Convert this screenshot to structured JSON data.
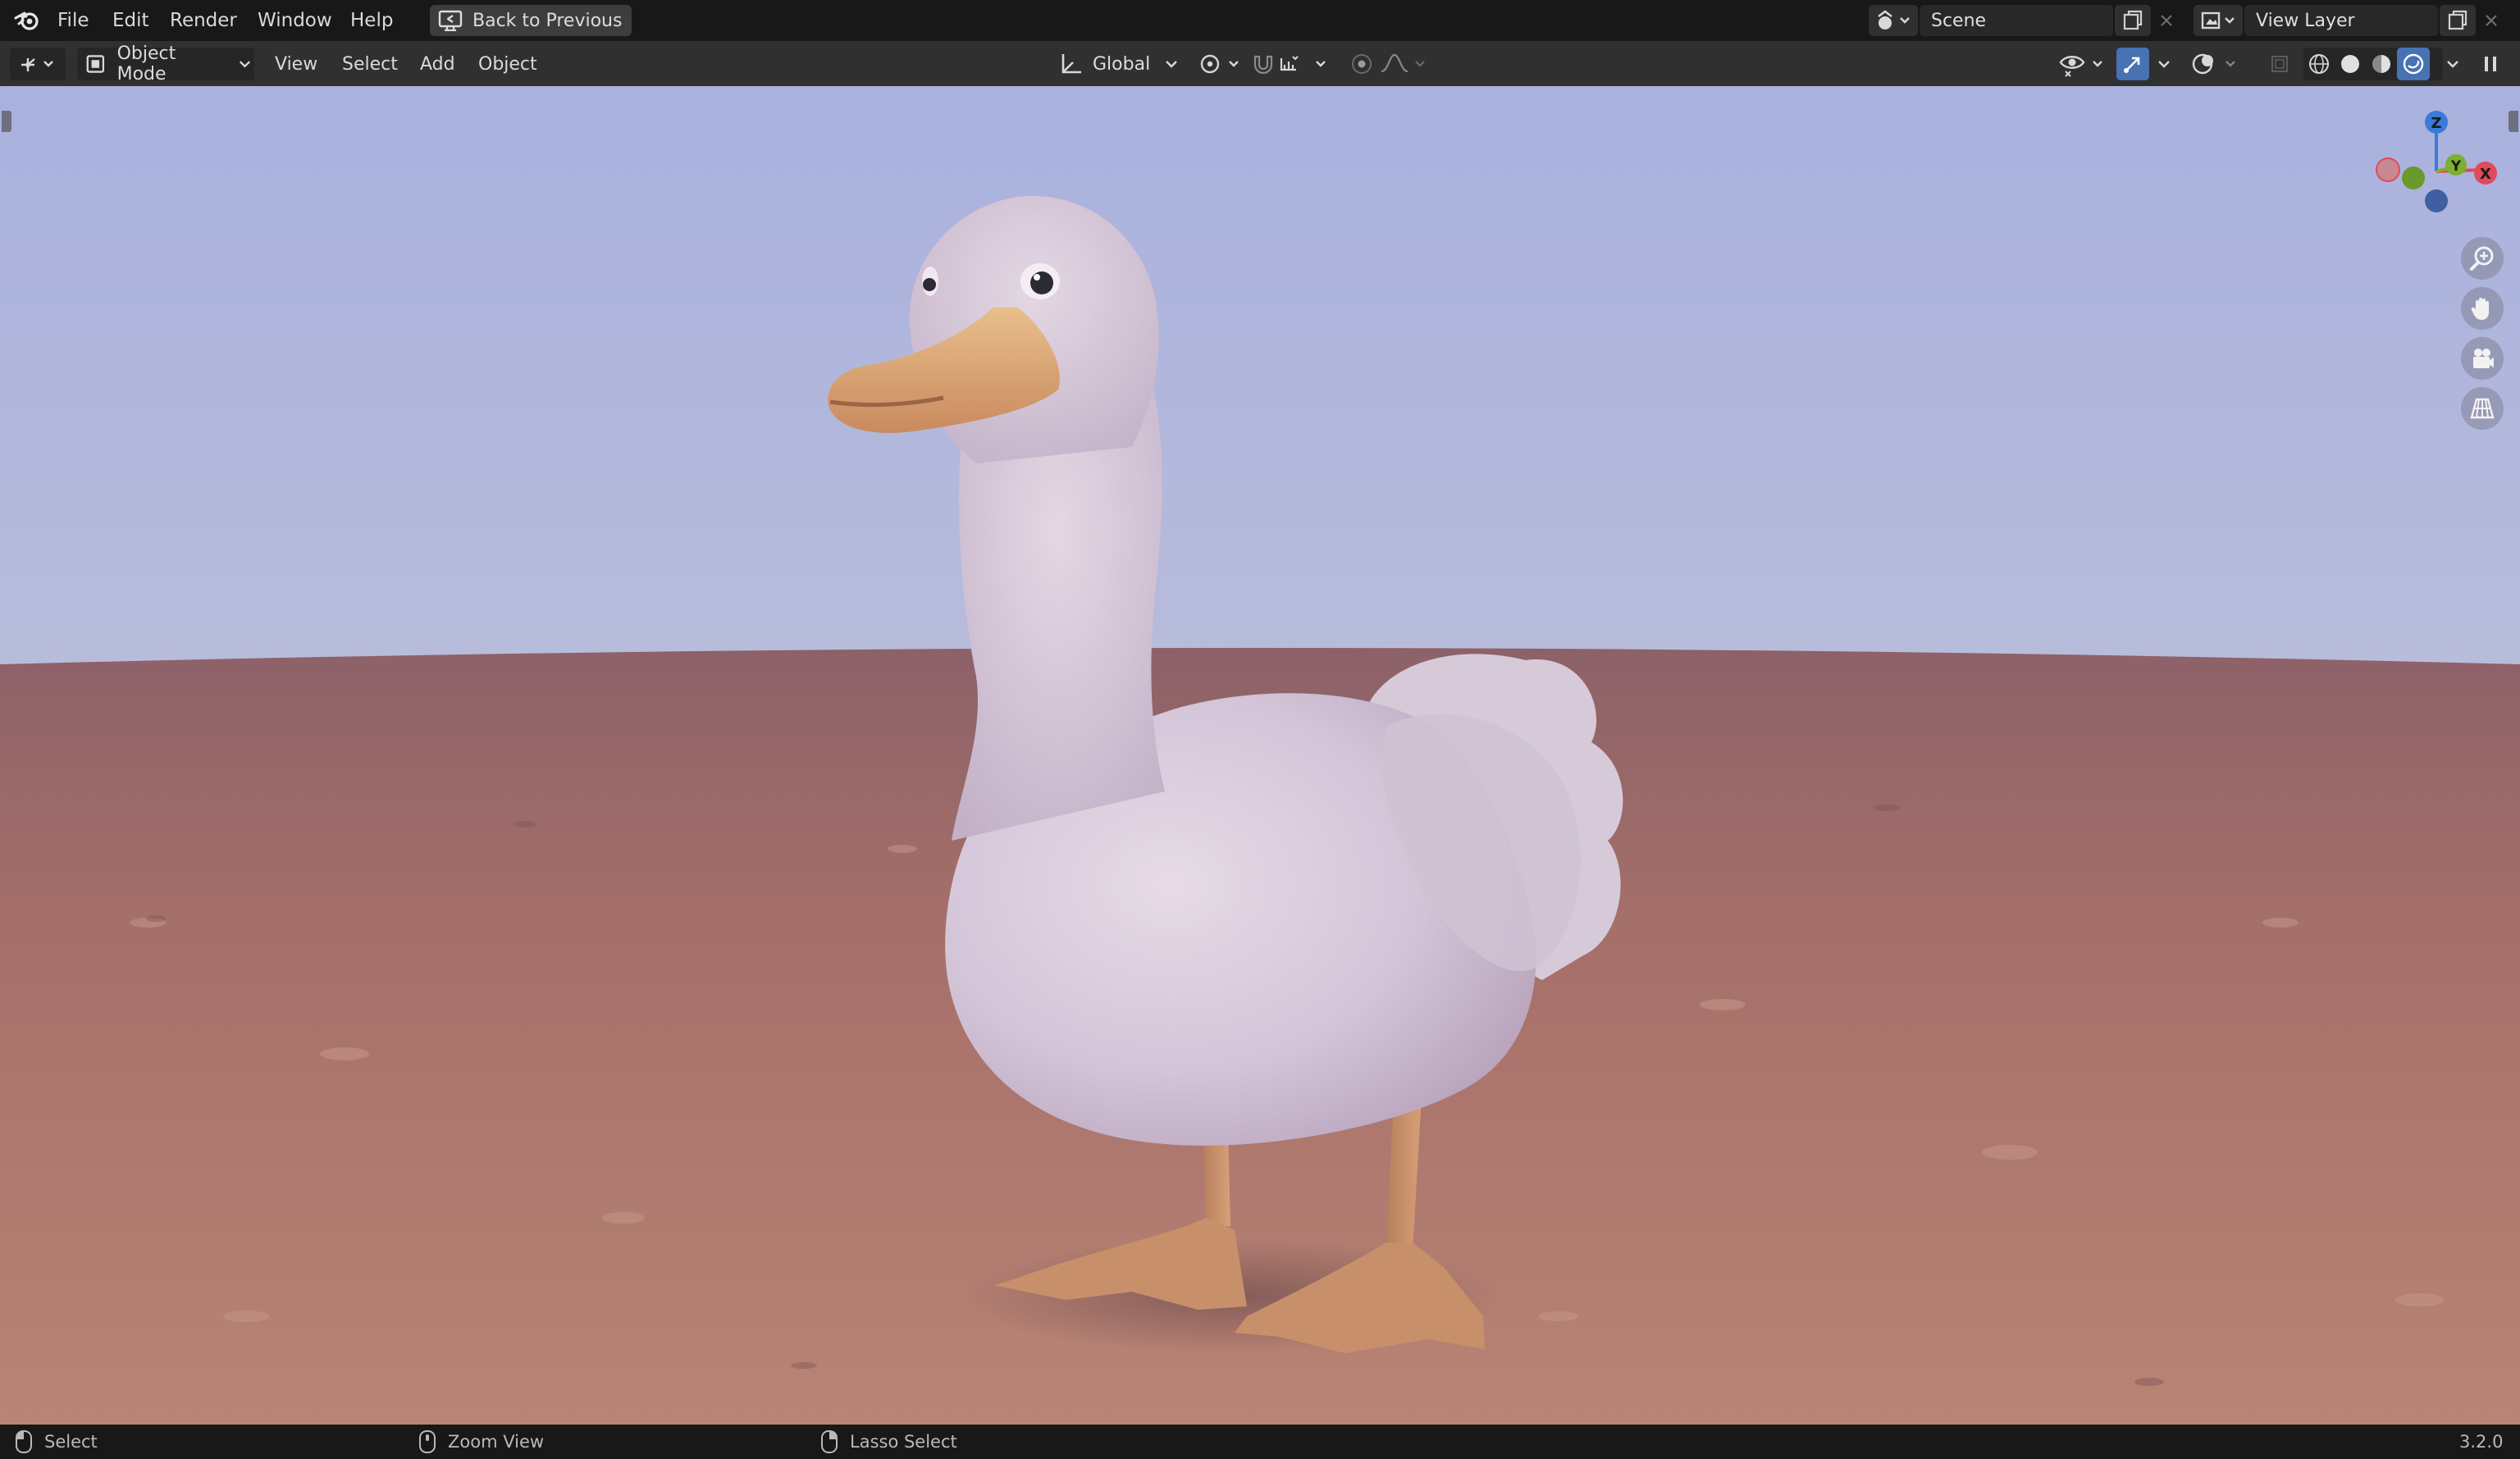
{
  "menubar": {
    "items": [
      "File",
      "Edit",
      "Render",
      "Window",
      "Help"
    ],
    "back_button": "Back to Previous",
    "scene_name": "Scene",
    "view_layer_name": "View Layer"
  },
  "viewport_header": {
    "mode": "Object Mode",
    "menus": [
      "View",
      "Select",
      "Add",
      "Object"
    ],
    "transform_orientation": "Global"
  },
  "gizmo": {
    "z_label": "Z",
    "y_label": "Y",
    "x_label": "X"
  },
  "statusbar": {
    "left_click": "Select",
    "middle_click": "Zoom View",
    "right_click": "Lasso Select",
    "version": "3.2.0"
  },
  "colors": {
    "accent": "#4772b3",
    "sky": "#b3b9dc",
    "ground": "#a56f6a",
    "duck_body": "#d9ccde",
    "duck_beak": "#d9a06c"
  }
}
